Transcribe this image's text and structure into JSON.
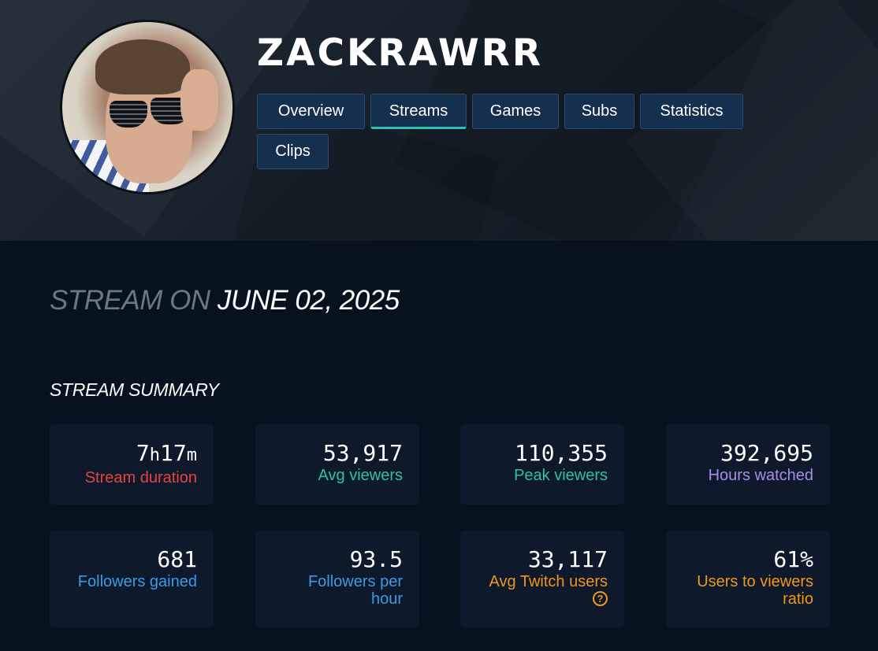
{
  "channel": {
    "username": "ZACKRAWRR"
  },
  "tabs": [
    {
      "label": "Overview",
      "active": false
    },
    {
      "label": "Streams",
      "active": true
    },
    {
      "label": "Games",
      "active": false
    },
    {
      "label": "Subs",
      "active": false
    },
    {
      "label": "Statistics",
      "active": false
    },
    {
      "label": "Clips",
      "active": false
    }
  ],
  "heading": {
    "prefix": "STREAM ON",
    "date": "JUNE 02, 2025"
  },
  "summary": {
    "title": "STREAM SUMMARY",
    "stats": [
      {
        "hours": "7",
        "h": "h",
        "minutes": "17",
        "m": "m",
        "label": "Stream duration",
        "color": "#e84343"
      },
      {
        "value": "53,917",
        "label": "Avg viewers",
        "color": "#2dc2a0"
      },
      {
        "value": "110,355",
        "label": "Peak viewers",
        "color": "#2dc2a0"
      },
      {
        "value": "392,695",
        "label": "Hours watched",
        "color": "#a98be8"
      },
      {
        "value": "681",
        "label": "Followers gained",
        "color": "#3a9be6"
      },
      {
        "value": "93.5",
        "label_line1": "Followers per",
        "label_line2": "hour",
        "color": "#3a9be6"
      },
      {
        "value": "33,117",
        "label": "Avg Twitch users",
        "color": "#f1961b",
        "help_icon": "question-circle-icon"
      },
      {
        "value": "61%",
        "label_line1": "Users to viewers",
        "label_line2": "ratio",
        "color": "#f1961b"
      }
    ]
  }
}
